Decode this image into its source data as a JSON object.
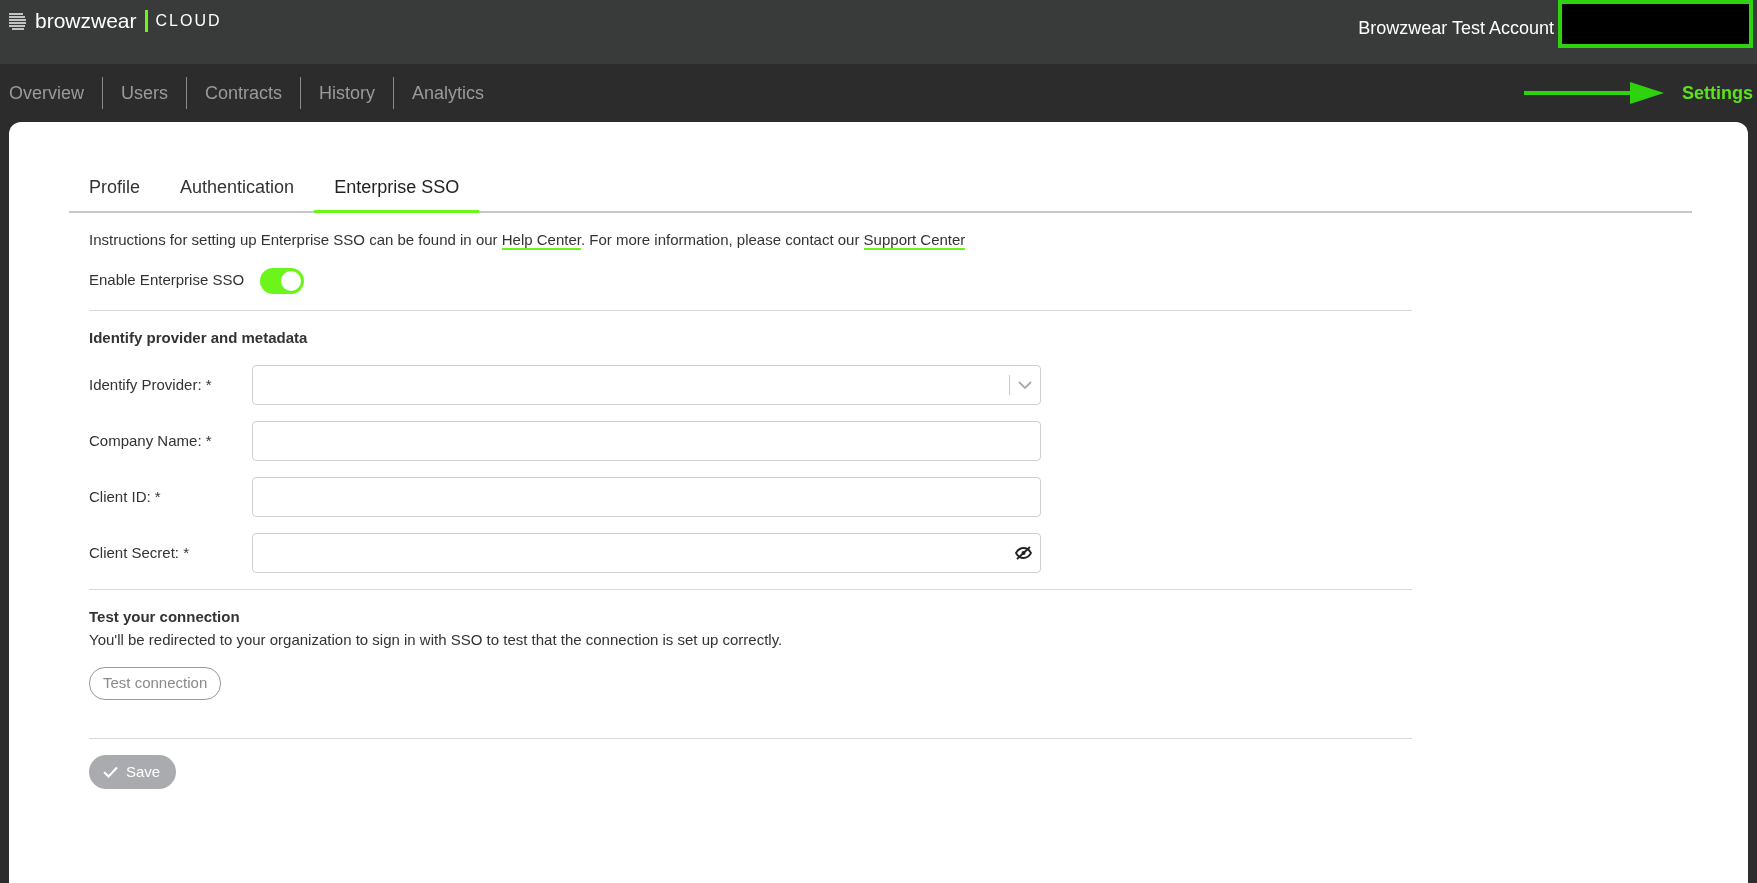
{
  "header": {
    "brand": "browzwear",
    "product": "CLOUD",
    "account": "Browzwear Test Account"
  },
  "nav": [
    {
      "label": "Overview",
      "selected": false
    },
    {
      "label": "Users",
      "selected": false
    },
    {
      "label": "Contracts",
      "selected": false
    },
    {
      "label": "History",
      "selected": false
    },
    {
      "label": "Analytics",
      "selected": false
    }
  ],
  "settings": {
    "label": "Settings",
    "selected": true
  },
  "tabs": [
    {
      "label": "Profile",
      "selected": false
    },
    {
      "label": "Authentication",
      "selected": false
    },
    {
      "label": "Enterprise SSO",
      "selected": true
    }
  ],
  "intro": [
    {
      "kind": "text",
      "text": "Instructions for setting up Enterprise SSO can be found in our "
    },
    {
      "kind": "link",
      "text": "Help Center"
    },
    {
      "kind": "text",
      "text": ". For more information, please contact our "
    },
    {
      "kind": "link",
      "text": "Support Center"
    }
  ],
  "enable_sso": {
    "label": "Enable Enterprise SSO",
    "on": true
  },
  "provider_section": {
    "title": "Identify provider and metadata"
  },
  "fields": [
    {
      "label": "Identify Provider: *",
      "kind": "select"
    },
    {
      "label": "Company Name: *",
      "kind": "text"
    },
    {
      "label": "Client ID: *",
      "kind": "text"
    },
    {
      "label": "Client Secret: *",
      "kind": "secret"
    }
  ],
  "test_section": {
    "title": "Test your connection",
    "description": "You'll be redirected to your organization to sign in with SSO to test that the connection is set up correctly.",
    "button": {
      "label": "Test connection",
      "disabled": true
    }
  },
  "save_button": {
    "label": "Save",
    "disabled": true
  }
}
